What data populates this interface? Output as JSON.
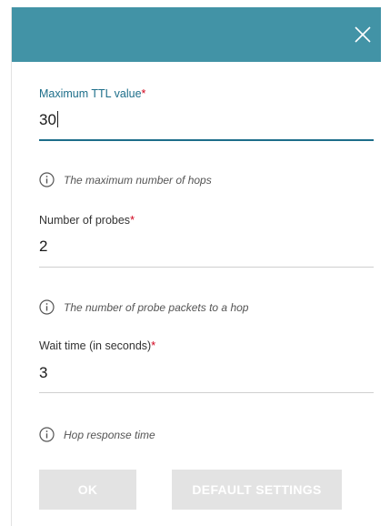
{
  "dialog": {
    "header_color": "#4293a6",
    "accent_color": "#1d6e8a",
    "required_color": "#d0021b"
  },
  "fields": [
    {
      "label": "Maximum TTL value",
      "required_mark": "*",
      "value": "30",
      "hint": "The maximum number of hops"
    },
    {
      "label": "Number of probes",
      "required_mark": "*",
      "value": "2",
      "hint": "The number of probe packets to a hop"
    },
    {
      "label": "Wait time (in seconds)",
      "required_mark": "*",
      "value": "3",
      "hint": "Hop response time"
    }
  ],
  "buttons": {
    "ok_label": "OK",
    "default_label": "DEFAULT SETTINGS"
  },
  "icons": {
    "close": "close-icon",
    "info": "info-icon"
  }
}
